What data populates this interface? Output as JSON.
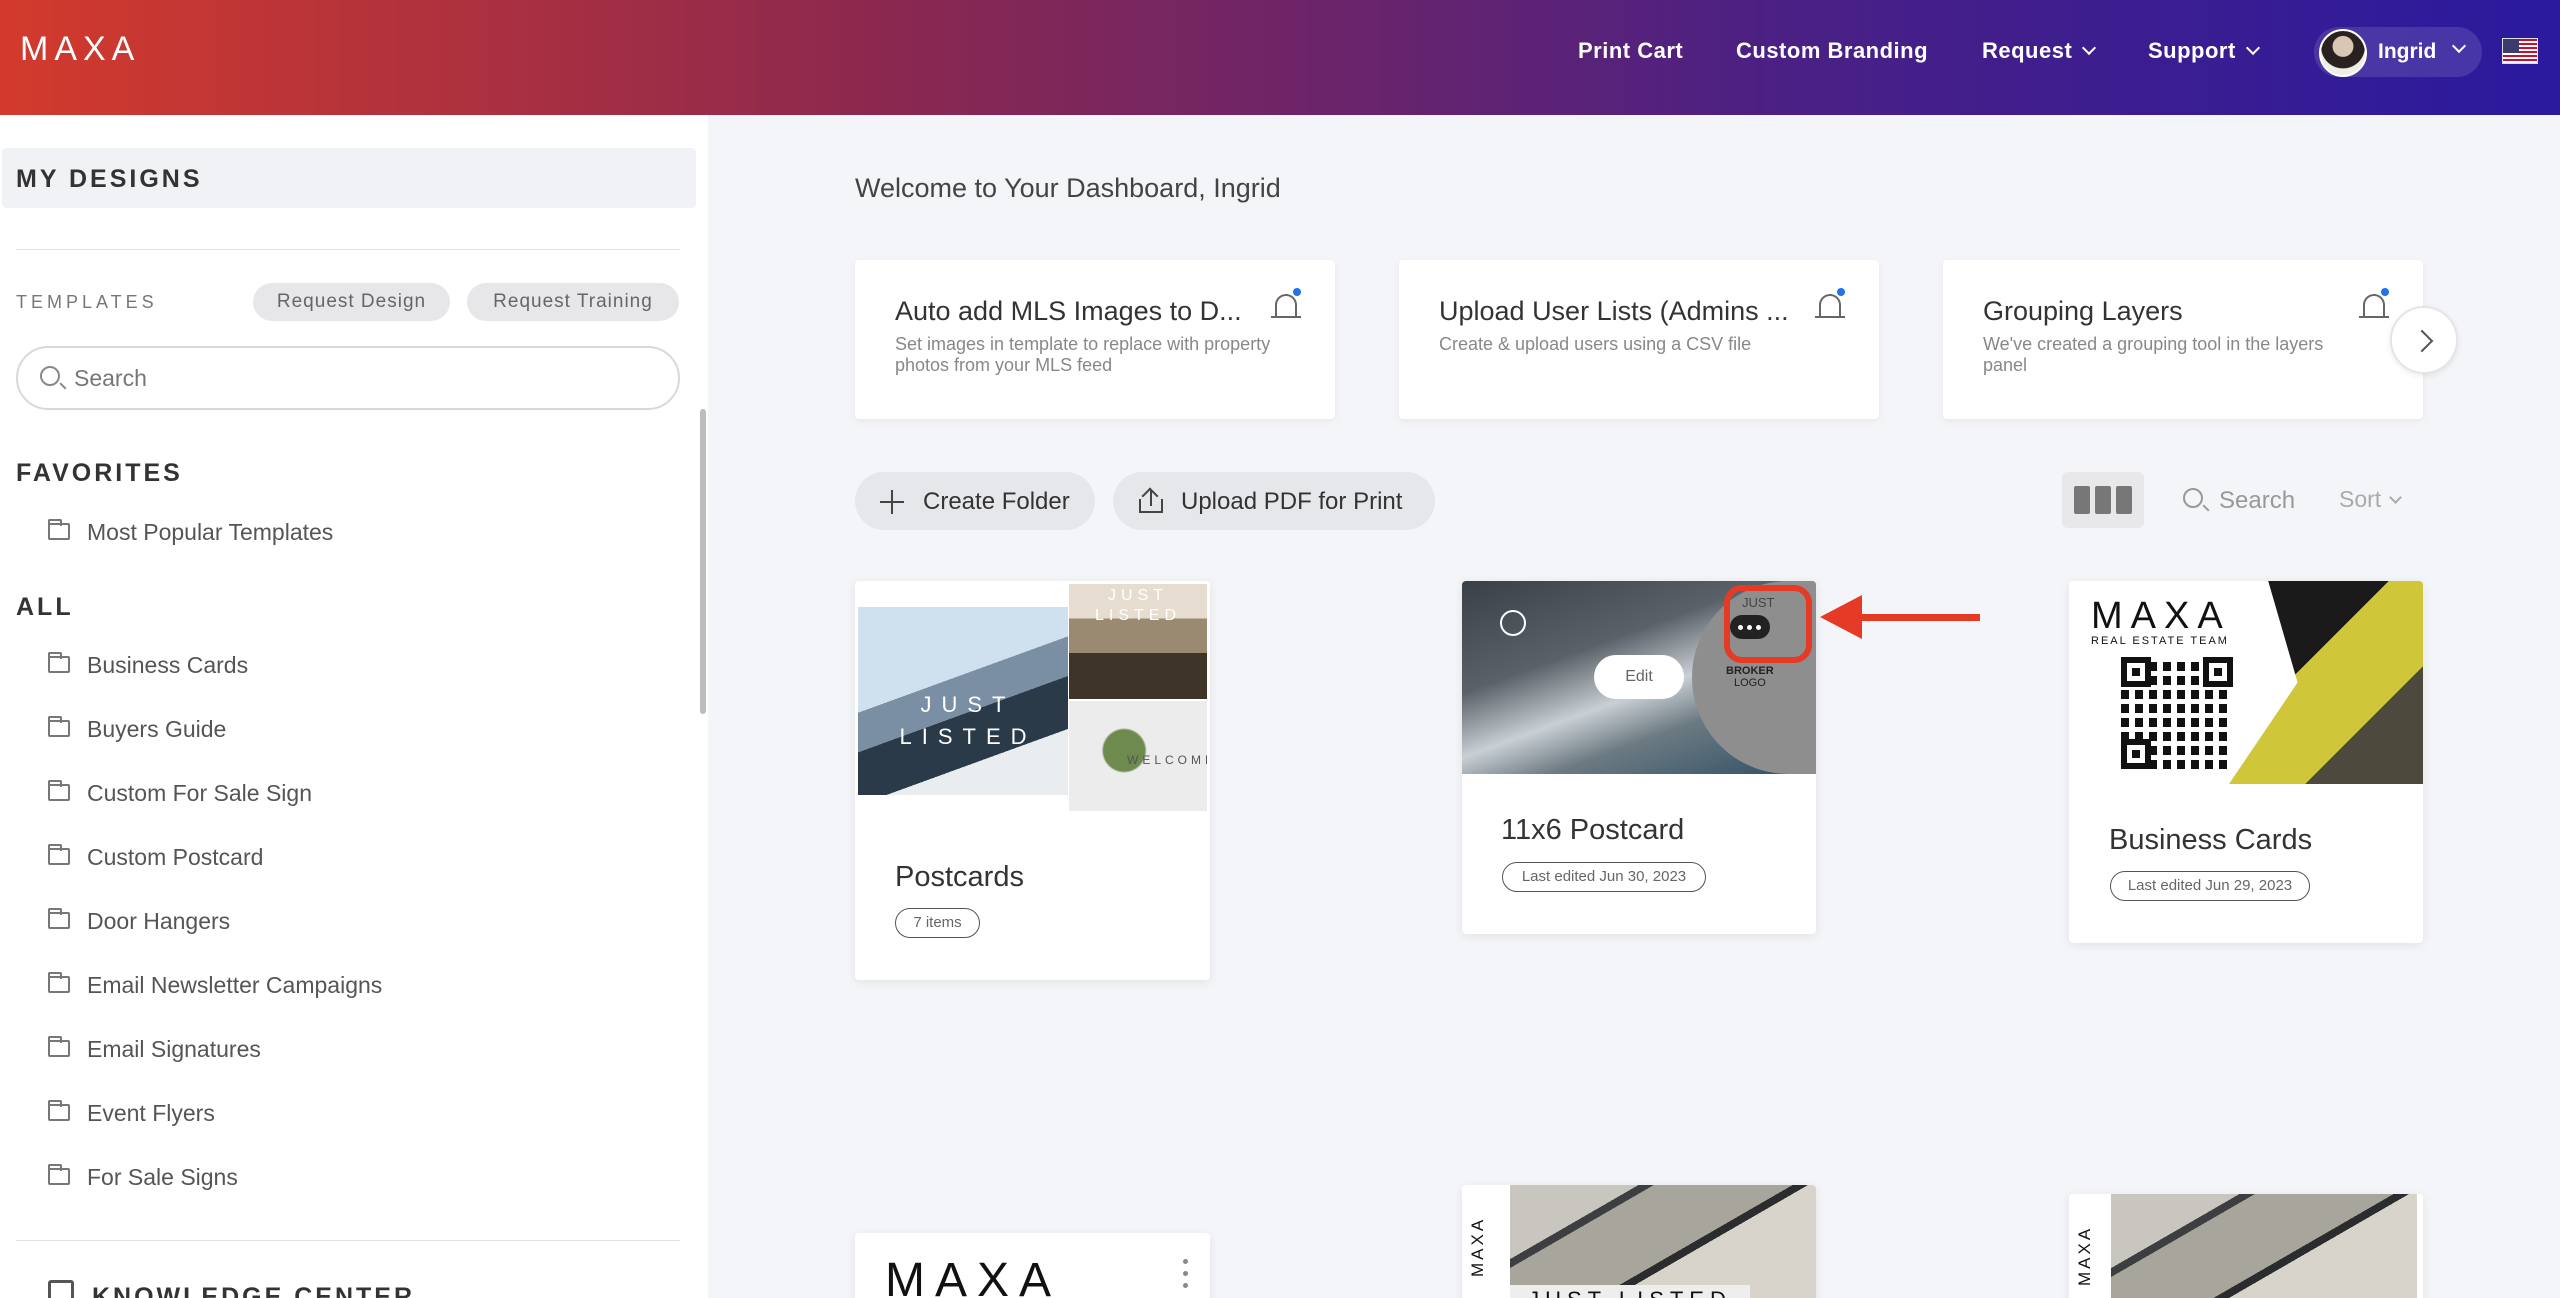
{
  "header": {
    "logo": "MAXA",
    "nav": [
      {
        "label": "Print Cart"
      },
      {
        "label": "Custom Branding"
      },
      {
        "label": "Request"
      },
      {
        "label": "Support"
      }
    ],
    "user": {
      "name": "Ingrid"
    }
  },
  "sidebar": {
    "title": "MY DESIGNS",
    "templates_label": "TEMPLATES",
    "request_design": "Request Design",
    "request_training": "Request Training",
    "search_placeholder": "Search",
    "favorites_title": "FAVORITES",
    "favorites": [
      {
        "label": "Most Popular Templates"
      }
    ],
    "all_title": "ALL",
    "folders": [
      {
        "label": "Business Cards"
      },
      {
        "label": "Buyers Guide"
      },
      {
        "label": "Custom For Sale Sign"
      },
      {
        "label": "Custom Postcard"
      },
      {
        "label": "Door Hangers"
      },
      {
        "label": "Email Newsletter Campaigns"
      },
      {
        "label": "Email Signatures"
      },
      {
        "label": "Event Flyers"
      },
      {
        "label": "For Sale Signs"
      }
    ],
    "knowledge_center": "KNOWLEDGE CENTER"
  },
  "main": {
    "welcome": "Welcome to Your Dashboard, Ingrid",
    "notifications": [
      {
        "title": "Auto add MLS Images to D...",
        "desc": "Set images in template to replace with property photos from your MLS feed"
      },
      {
        "title": "Upload User Lists (Admins ...",
        "desc": "Create & upload users using a CSV file"
      },
      {
        "title": "Grouping Layers",
        "desc": "We've created a grouping tool in the layers panel"
      }
    ],
    "create_folder": "Create Folder",
    "upload_pdf": "Upload PDF for Print",
    "search": "Search",
    "sort": "Sort",
    "cards": [
      {
        "title": "Postcards",
        "meta": "7 items",
        "thumb_text_1": "JUST LISTED",
        "thumb_text_2": "JUST LISTED",
        "thumb_text_3": "WELCOME"
      },
      {
        "title": "11x6 Postcard",
        "meta": "Last edited Jun 30, 2023",
        "edit": "Edit",
        "broker": "BROKER",
        "broker_sub": "LOGO",
        "corner_text": "JUST"
      },
      {
        "title": "Business Cards",
        "meta": "Last edited Jun 29, 2023",
        "logo": "MAXA",
        "sub": "REAL ESTATE TEAM"
      }
    ],
    "bottom_cards": [
      {
        "logo": "MAXA"
      },
      {
        "vertical": "MAXA",
        "band": "JUST LISTED"
      },
      {
        "vertical": "MAXA"
      }
    ]
  },
  "colors": {
    "accent": "#e53a25",
    "header_start": "#d33a2c",
    "header_end": "#2a1a9e"
  }
}
